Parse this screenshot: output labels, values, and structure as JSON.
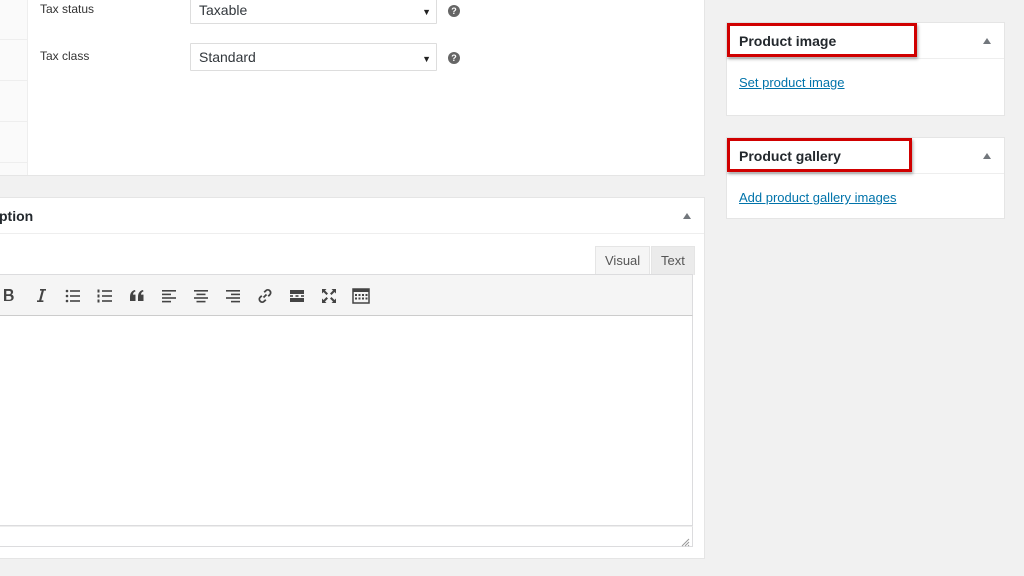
{
  "product_data": {
    "fields": [
      {
        "label": "Tax status",
        "value": "Taxable"
      },
      {
        "label": "Tax class",
        "value": "Standard"
      }
    ],
    "help_glyph": "?"
  },
  "short_description": {
    "title": "ption",
    "tabs": {
      "visual": "Visual",
      "text": "Text"
    },
    "toolbar": [
      "bold-icon",
      "italic-icon",
      "bullet-list-icon",
      "numbered-list-icon",
      "blockquote-icon",
      "align-left-icon",
      "align-center-icon",
      "align-right-icon",
      "link-icon",
      "read-more-icon",
      "fullscreen-icon",
      "toolbar-toggle-icon"
    ]
  },
  "sidebar": {
    "product_image": {
      "title": "Product image",
      "link": "Set product image"
    },
    "product_gallery": {
      "title": "Product gallery",
      "link": "Add product gallery images"
    }
  },
  "colors": {
    "highlight": "#d00000",
    "link": "#0073aa",
    "background": "#f1f1f1"
  }
}
